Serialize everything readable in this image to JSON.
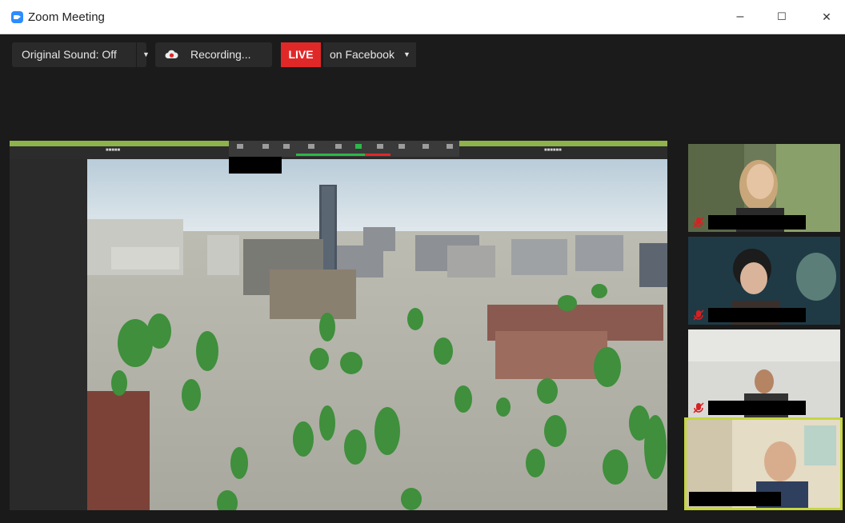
{
  "window": {
    "title": "Zoom Meeting",
    "minimize_label": "–",
    "maximize_label": "☐",
    "close_label": "✕"
  },
  "toolbar": {
    "original_sound_label": "Original Sound: Off",
    "recording_label": "Recording...",
    "live_label": "LIVE",
    "live_target_label": "on Facebook"
  },
  "icons": {
    "app": "zoom-logo-icon",
    "recording": "cloud-record-icon",
    "dropdown": "chevron-down-icon",
    "mic": "mic-muted-icon"
  },
  "colors": {
    "live_red": "#e02828",
    "zoom_blue": "#2d8cff",
    "active_speaker": "#c4d640",
    "muted_red": "#d82020"
  },
  "participants": [
    {
      "id": "participant-1",
      "muted": true,
      "active": false
    },
    {
      "id": "participant-2",
      "muted": true,
      "active": false
    },
    {
      "id": "participant-3",
      "muted": true,
      "active": false
    },
    {
      "id": "participant-4",
      "muted": false,
      "active": true
    }
  ]
}
